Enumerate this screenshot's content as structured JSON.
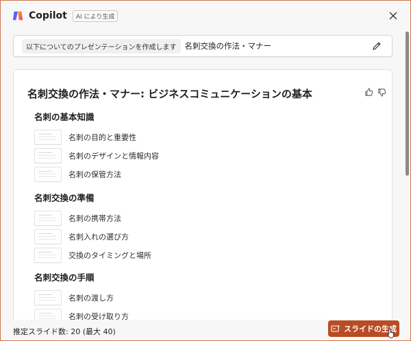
{
  "app": {
    "name": "Copilot",
    "badge": "AI により生成",
    "accent": "#b84c23"
  },
  "prompt": {
    "prefix": "以下についてのプレゼンテーションを作成します",
    "topic": "名刺交換の作法・マナー"
  },
  "outline": {
    "title": "名刺交換の作法・マナー: ビジネスコミュニケーションの基本",
    "sections": [
      {
        "heading": "名刺の基本知識",
        "slides": [
          "名刺の目的と重要性",
          "名刺のデザインと情報内容",
          "名刺の保管方法"
        ]
      },
      {
        "heading": "名刺交換の準備",
        "slides": [
          "名刺の携帯方法",
          "名刺入れの選び方",
          "交換のタイミングと場所"
        ]
      },
      {
        "heading": "名刺交換の手順",
        "slides": [
          "名刺の渡し方",
          "名刺の受け取り方"
        ]
      }
    ]
  },
  "footer": {
    "estimate": "推定スライド数: 20 (最大 40)",
    "generate_label": "スライドの生成"
  },
  "icons": {
    "logo": "copilot-logo",
    "close": "close-icon",
    "edit": "pencil-icon",
    "like": "thumbs-up-icon",
    "dislike": "thumbs-down-icon",
    "generate": "slides-icon"
  }
}
